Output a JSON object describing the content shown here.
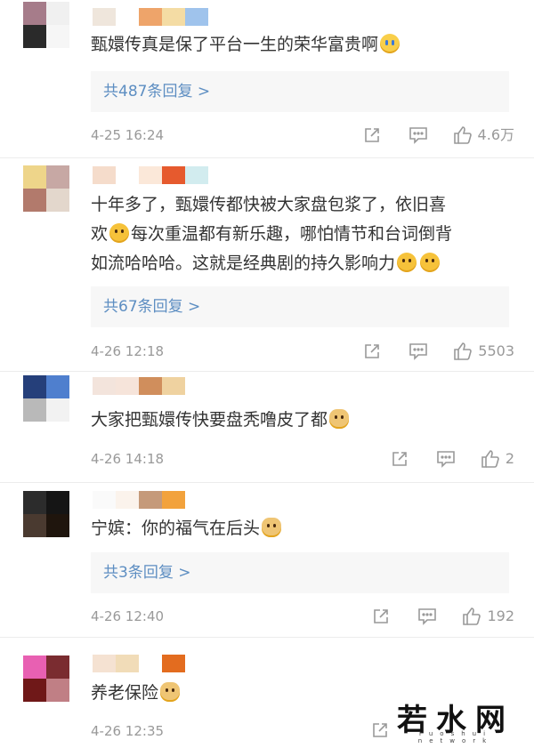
{
  "comments": [
    {
      "text": "甄嬛传真是保了平台一生的荣华富贵啊",
      "emoji_after": "cry-emoji",
      "replies_label": "共487条回复 >",
      "time": "4-25 16:24",
      "likes": "4.6万",
      "avatar_colors": [
        "#a67c8a",
        "#f0f0f0",
        "#2a2a2a",
        "#f6f6f6"
      ],
      "name_colors": [
        "#efe6dc",
        "#ffffff",
        "#eea46a",
        "#f4dca4",
        "#9fc3ec"
      ]
    },
    {
      "text_line1": "十年多了，甄嬛传都快被大家盘包浆了，依旧喜",
      "text_line2_a": "欢",
      "text_line2_b": "每次重温都有新乐趣，哪怕情节和台词倒背",
      "text_line3": "如流哈哈哈。这就是经典剧的持久影响力",
      "replies_label": "共67条回复 >",
      "time": "4-26 12:18",
      "likes": "5503",
      "avatar_colors": [
        "#eed58a",
        "#c7a8a4",
        "#b27a6c",
        "#e3d7cc"
      ],
      "name_colors": [
        "#f5dccb",
        "#ffffff",
        "#fbe8d9",
        "#e65a2e",
        "#d2ecef"
      ]
    },
    {
      "text": "大家把甄嬛传快要盘秃噜皮了都",
      "time": "4-26 14:18",
      "likes": "2",
      "avatar_colors": [
        "#253f7a",
        "#4f7fce",
        "#b9b9b9",
        "#f2f2f2"
      ],
      "name_colors": [
        "#f3e4dc",
        "#f6e4da",
        "#d08e5c",
        "#efd2a0"
      ]
    },
    {
      "text": "宁嫔：你的福气在后头",
      "replies_label": "共3条回复 >",
      "time": "4-26 12:40",
      "likes": "192",
      "avatar_colors": [
        "#2c2c2c",
        "#151515",
        "#4a3a30",
        "#1f150d"
      ],
      "name_colors": [
        "#fafafa",
        "#fbf3ec",
        "#c59a7a",
        "#f2a23c"
      ]
    },
    {
      "text": "养老保险",
      "time": "4-26 12:35",
      "avatar_colors": [
        "#e860b2",
        "#7a2c30",
        "#6f1818",
        "#c07f85"
      ],
      "name_colors": [
        "#f5e2d2",
        "#f1dcb8",
        "#ffffff",
        "#e36c1f"
      ]
    }
  ],
  "watermark": {
    "text": "若水网",
    "sub": "ruoshui network"
  }
}
